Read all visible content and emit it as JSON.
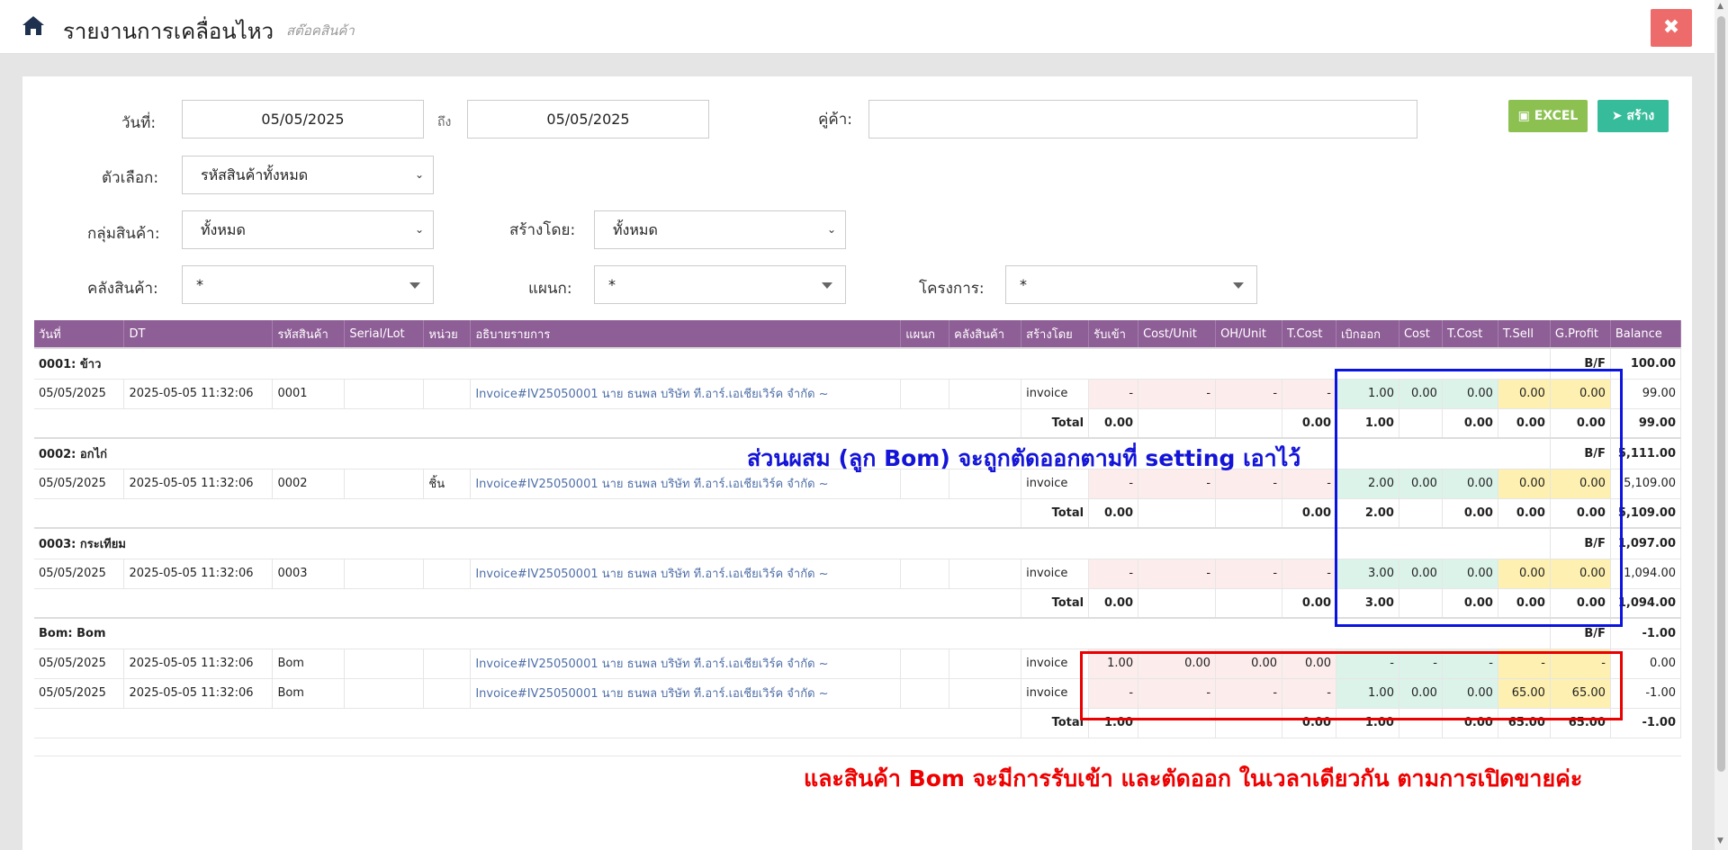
{
  "header": {
    "title": "รายงานการเคลื่อนไหว",
    "subtitle": "สต๊อคสินค้า",
    "close_label": "✖"
  },
  "filters": {
    "date_label": "วันที่:",
    "date_from": "05/05/2025",
    "to_label": "ถึง",
    "date_to": "05/05/2025",
    "partner_label": "คู่ค้า:",
    "partner_value": "",
    "option_label": "ตัวเลือก:",
    "option_value": "รหัสสินค้าทั้งหมด",
    "group_label": "กลุ่มสินค้า:",
    "group_value": "ทั้งหมด",
    "created_by_label": "สร้างโดย:",
    "created_by_value": "ทั้งหมด",
    "warehouse_label": "คลังสินค้า:",
    "warehouse_value": "*",
    "department_label": "แผนก:",
    "department_value": "*",
    "project_label": "โครงการ:",
    "project_value": "*"
  },
  "buttons": {
    "excel": "EXCEL",
    "create": "สร้าง"
  },
  "columns": [
    "วันที่",
    "DT",
    "รหัสสินค้า",
    "Serial/Lot",
    "หน่วย",
    "อธิบายรายการ",
    "แผนก",
    "คลังสินค้า",
    "สร้างโดย",
    "รับเข้า",
    "Cost/Unit",
    "OH/Unit",
    "T.Cost",
    "เบิกออก",
    "Cost",
    "T.Cost",
    "T.Sell",
    "G.Profit",
    "Balance"
  ],
  "groups": [
    {
      "name": "0001: ข้าว",
      "bf_label": "B/F",
      "bf": "100.00",
      "rows": [
        [
          "05/05/2025",
          "2025-05-05 11:32:06",
          "0001",
          "",
          "",
          "Invoice#IV25050001 นาย ธนพล บริษัท ที.อาร์.เอเชียเวิร์ค จำกัด ~",
          "",
          "",
          "invoice",
          "-",
          "-",
          "-",
          "-",
          "1.00",
          "0.00",
          "0.00",
          "0.00",
          "0.00",
          "99.00"
        ]
      ],
      "total": [
        "Total",
        "0.00",
        "",
        "",
        "0.00",
        "1.00",
        "",
        "0.00",
        "0.00",
        "0.00",
        "99.00"
      ]
    },
    {
      "name": "0002: อกไก่",
      "bf_label": "B/F",
      "bf": "5,111.00",
      "rows": [
        [
          "05/05/2025",
          "2025-05-05 11:32:06",
          "0002",
          "",
          "ชิ้น",
          "Invoice#IV25050001 นาย ธนพล บริษัท ที.อาร์.เอเชียเวิร์ค จำกัด ~",
          "",
          "",
          "invoice",
          "-",
          "-",
          "-",
          "-",
          "2.00",
          "0.00",
          "0.00",
          "0.00",
          "0.00",
          "5,109.00"
        ]
      ],
      "total": [
        "Total",
        "0.00",
        "",
        "",
        "0.00",
        "2.00",
        "",
        "0.00",
        "0.00",
        "0.00",
        "5,109.00"
      ]
    },
    {
      "name": "0003: กระเทียม",
      "bf_label": "B/F",
      "bf": "1,097.00",
      "rows": [
        [
          "05/05/2025",
          "2025-05-05 11:32:06",
          "0003",
          "",
          "",
          "Invoice#IV25050001 นาย ธนพล บริษัท ที.อาร์.เอเชียเวิร์ค จำกัด ~",
          "",
          "",
          "invoice",
          "-",
          "-",
          "-",
          "-",
          "3.00",
          "0.00",
          "0.00",
          "0.00",
          "0.00",
          "1,094.00"
        ]
      ],
      "total": [
        "Total",
        "0.00",
        "",
        "",
        "0.00",
        "3.00",
        "",
        "0.00",
        "0.00",
        "0.00",
        "1,094.00"
      ]
    },
    {
      "name": "Bom: Bom",
      "bf_label": "B/F",
      "bf": "-1.00",
      "rows": [
        [
          "05/05/2025",
          "2025-05-05 11:32:06",
          "Bom",
          "",
          "",
          "Invoice#IV25050001 นาย ธนพล บริษัท ที.อาร์.เอเชียเวิร์ค จำกัด ~",
          "",
          "",
          "invoice",
          "1.00",
          "0.00",
          "0.00",
          "0.00",
          "-",
          "-",
          "-",
          "-",
          "-",
          "0.00"
        ],
        [
          "05/05/2025",
          "2025-05-05 11:32:06",
          "Bom",
          "",
          "",
          "Invoice#IV25050001 นาย ธนพล บริษัท ที.อาร์.เอเชียเวิร์ค จำกัด ~",
          "",
          "",
          "invoice",
          "-",
          "-",
          "-",
          "-",
          "1.00",
          "0.00",
          "0.00",
          "65.00",
          "65.00",
          "-1.00"
        ]
      ],
      "total": [
        "Total",
        "1.00",
        "",
        "",
        "0.00",
        "1.00",
        "",
        "0.00",
        "65.00",
        "65.00",
        "-1.00"
      ]
    }
  ],
  "annotations": {
    "note_blue": "ส่วนผสม (ลูก Bom) จะถูกตัดออกตามที่ setting เอาไว้",
    "note_red": "และสินค้า Bom จะมีการรับเข้า และตัดออก ในเวลาเดียวกัน ตามการเปิดขายค่ะ"
  }
}
